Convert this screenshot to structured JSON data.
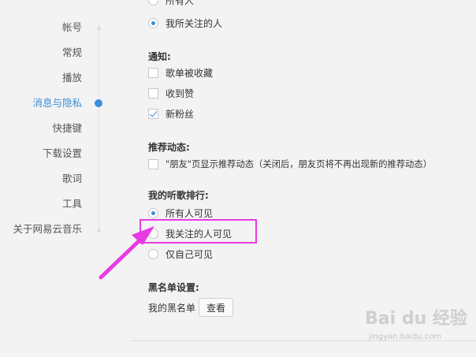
{
  "sidebar": {
    "items": [
      {
        "label": "帐号",
        "active": false
      },
      {
        "label": "常规",
        "active": false
      },
      {
        "label": "播放",
        "active": false
      },
      {
        "label": "消息与隐私",
        "active": true
      },
      {
        "label": "快捷键",
        "active": false
      },
      {
        "label": "下载设置",
        "active": false
      },
      {
        "label": "歌词",
        "active": false
      },
      {
        "label": "工具",
        "active": false
      },
      {
        "label": "关于网易云音乐",
        "active": false
      }
    ]
  },
  "message_scope": {
    "cut_option": "所有人",
    "selected_option": "我所关注的人"
  },
  "notifications": {
    "title": "通知:",
    "options": [
      {
        "label": "歌单被收藏",
        "checked": false
      },
      {
        "label": "收到赞",
        "checked": false
      },
      {
        "label": "新粉丝",
        "checked": true
      }
    ]
  },
  "recommend": {
    "title": "推荐动态:",
    "option": {
      "label": "\"朋友\"页显示推荐动态（关闭后，朋友页将不再出现新的推荐动态）",
      "checked": false
    }
  },
  "ranking": {
    "title": "我的听歌排行:",
    "options": [
      {
        "label": "所有人可见",
        "checked": true
      },
      {
        "label": "我关注的人可见",
        "checked": false
      },
      {
        "label": "仅自己可见",
        "checked": false
      }
    ]
  },
  "blacklist": {
    "title": "黑名单设置:",
    "label": "我的黑名单",
    "button": "查看"
  },
  "watermark": {
    "brand": "Bai du 经验",
    "url": "jingyan.baidu.com"
  },
  "colors": {
    "accent": "#3a8fd9",
    "highlight": "#e93ae5"
  }
}
